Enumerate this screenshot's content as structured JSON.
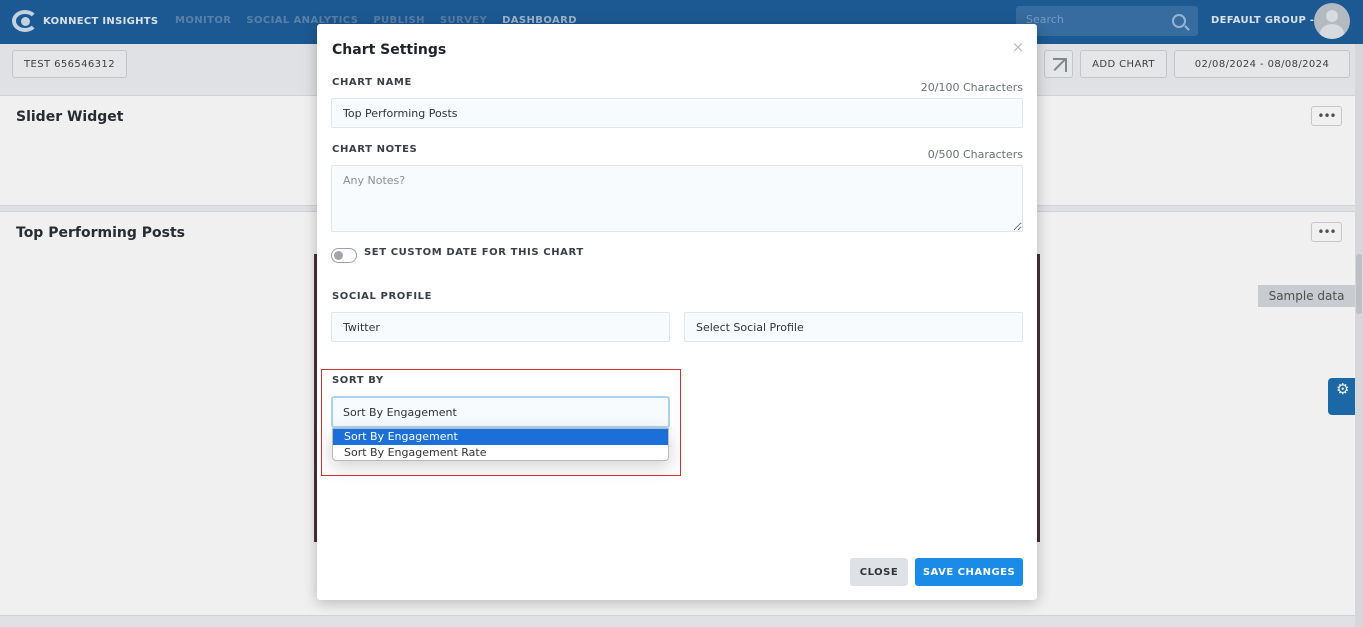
{
  "app": {
    "logo_text": "KONNECT INSIGHTS",
    "nav": [
      "MONITOR",
      "SOCIAL ANALYTICS",
      "PUBLISH",
      "SURVEY",
      "DASHBOARD"
    ],
    "active_nav": "DASHBOARD",
    "search_placeholder": "Search",
    "group_label": "DEFAULT GROUP -"
  },
  "toolbar": {
    "dashboard_name": "TEST 656546312",
    "add_chart_label": "ADD CHART",
    "date_range": "02/08/2024 - 08/08/2024"
  },
  "widgets": [
    {
      "title": "Slider Widget",
      "menu": "•••"
    },
    {
      "title": "Top Performing Posts",
      "menu": "•••",
      "badge": "Sample data"
    }
  ],
  "modal": {
    "title": "Chart Settings",
    "close_glyph": "×",
    "chart_name_label": "CHART NAME",
    "chart_name_counter": "20/100 Characters",
    "chart_name_value": "Top Performing Posts",
    "chart_notes_label": "CHART NOTES",
    "chart_notes_counter": "0/500 Characters",
    "chart_notes_placeholder": "Any Notes?",
    "custom_date_label": "SET CUSTOM DATE FOR THIS CHART",
    "social_profile_label": "SOCIAL PROFILE",
    "social_network_value": "Twitter",
    "social_profile_placeholder": "Select Social Profile",
    "sort_by_label": "SORT BY",
    "sort_by_value": "Sort By Engagement",
    "sort_options": [
      "Sort By Engagement",
      "Sort By Engagement Rate"
    ],
    "close_button": "CLOSE",
    "save_button": "SAVE CHANGES"
  },
  "colors": {
    "topbar": "#1e5f9c",
    "primary": "#1a8be6",
    "dropdown_selected": "#1b6fd8",
    "highlight": "#d9302f"
  }
}
